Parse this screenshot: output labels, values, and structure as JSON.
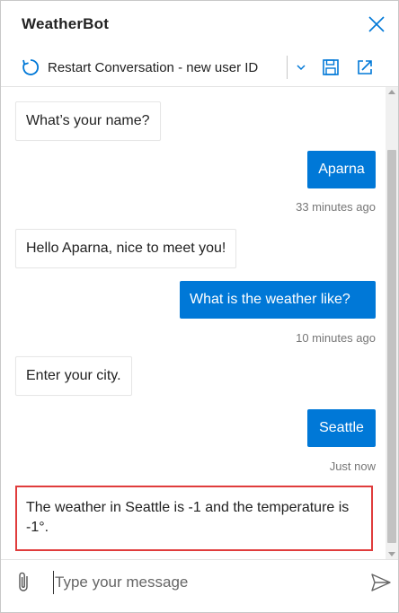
{
  "app": {
    "title": "WeatherBot",
    "accent_color": "#0078d7",
    "highlight_color": "#e03c3c"
  },
  "header": {
    "close_icon": "close-icon"
  },
  "toolbar": {
    "restart_label": "Restart Conversation - new user ID",
    "restart_icon": "refresh-icon",
    "dropdown_icon": "chevron-down-icon",
    "save_icon": "save-icon",
    "open_external_icon": "open-external-icon"
  },
  "messages": [
    {
      "from": "bot",
      "text": "What’s your name?"
    },
    {
      "from": "user",
      "text": "Aparna",
      "timestamp": "33 minutes ago"
    },
    {
      "from": "bot",
      "text": "Hello Aparna, nice to meet you!"
    },
    {
      "from": "user",
      "text": "What is the weather like?",
      "timestamp": "10 minutes ago"
    },
    {
      "from": "bot",
      "text": "Enter your city."
    },
    {
      "from": "user",
      "text": "Seattle",
      "timestamp": "Just now"
    },
    {
      "from": "bot",
      "text": "The weather in Seattle is -1 and the temperature is -1°.",
      "highlighted": true
    }
  ],
  "composer": {
    "placeholder": "Type your message",
    "attach_icon": "paperclip-icon",
    "send_icon": "send-icon"
  }
}
